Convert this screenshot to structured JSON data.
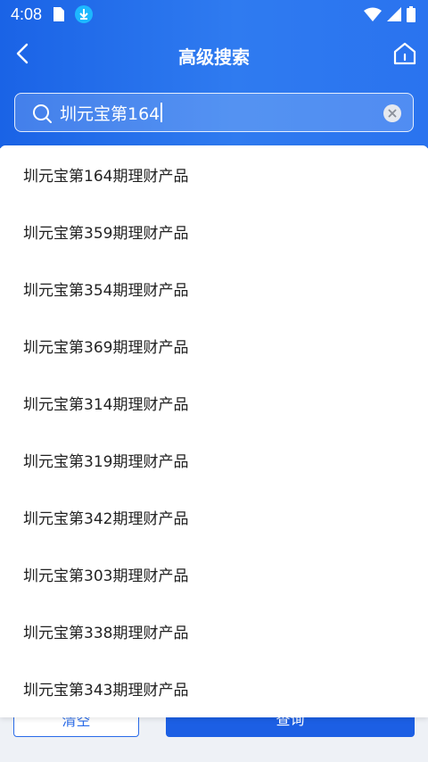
{
  "status": {
    "time": "4:08"
  },
  "header": {
    "title": "高级搜索"
  },
  "search": {
    "value": "圳元宝第164"
  },
  "suggestions": [
    "圳元宝第164期理财产品",
    "圳元宝第359期理财产品",
    "圳元宝第354期理财产品",
    "圳元宝第369期理财产品",
    "圳元宝第314期理财产品",
    "圳元宝第319期理财产品",
    "圳元宝第342期理财产品",
    "圳元宝第303期理财产品",
    "圳元宝第338期理财产品",
    "圳元宝第343期理财产品"
  ],
  "footer": {
    "reset_label": "清空",
    "query_label": "查询"
  },
  "icons": {
    "back": "back-arrow-icon",
    "home": "home-icon",
    "search": "search-icon",
    "clear": "clear-icon",
    "download": "download-icon",
    "wifi": "wifi-icon",
    "signal": "signal-icon",
    "battery": "battery-icon"
  },
  "colors": {
    "primary": "#1c5fe4",
    "header_gradient_start": "#1a63e6",
    "header_gradient_end": "#2a73ef"
  }
}
